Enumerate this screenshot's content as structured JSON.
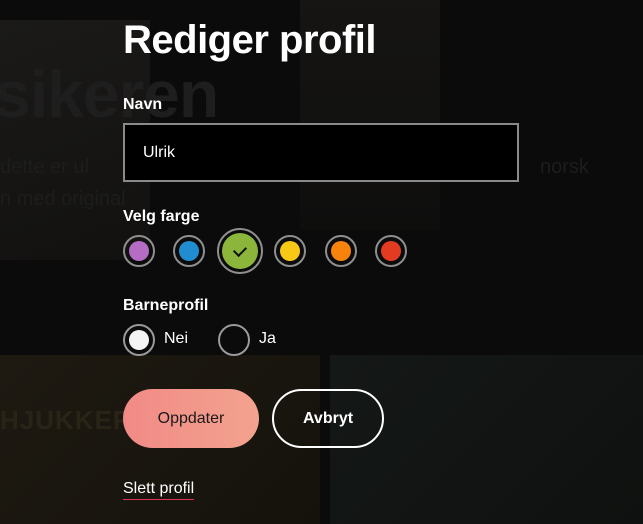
{
  "background": {
    "title_fragment": "sikeren",
    "text_line_1": "dette er ul",
    "text_line_2": "n med original",
    "text_line_3": "norsk",
    "strip_text": "HJUKKER"
  },
  "form": {
    "title": "Rediger profil",
    "name_label": "Navn",
    "name_value": "Ulrik",
    "color_label": "Velg farge",
    "colors": [
      {
        "name": "purple",
        "hex": "#b56cc4"
      },
      {
        "name": "blue",
        "hex": "#1f8dcf"
      },
      {
        "name": "green",
        "hex": "#8cb53b",
        "selected": true
      },
      {
        "name": "yellow",
        "hex": "#f7c916"
      },
      {
        "name": "orange",
        "hex": "#f7830c"
      },
      {
        "name": "red",
        "hex": "#e23b22"
      }
    ],
    "kids_label": "Barneprofil",
    "kids_options": [
      {
        "label": "Nei",
        "selected": true
      },
      {
        "label": "Ja",
        "selected": false
      }
    ],
    "update_button": "Oppdater",
    "cancel_button": "Avbryt",
    "delete_link": "Slett profil"
  }
}
